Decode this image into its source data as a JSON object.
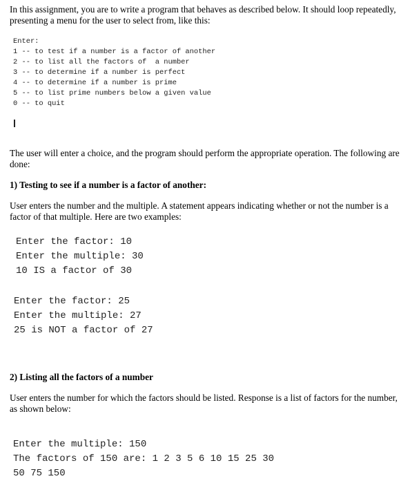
{
  "intro": {
    "line1": "In this assignment, you are to write a program that behaves as described below. It should loop repeatedly,",
    "line2": "presenting a menu for the user to select from, like this:"
  },
  "menu": {
    "header": "Enter:",
    "items": [
      "1 -- to test if a number is a factor of another",
      "2 -- to list all the factors of  a number",
      "3 -- to determine if a number is perfect",
      "4 -- to determine if a number is prime",
      "5 -- to list prime numbers below a given value",
      "0 -- to quit"
    ]
  },
  "choice_paragraph": {
    "line1": "The user will enter a choice, and the program should perform the appropriate operation. The following are",
    "line2": "done:"
  },
  "section1": {
    "heading": "1) Testing to see if a number is a factor of another:",
    "desc_line1": "User enters the number and the multiple. A statement appears indicating whether or not the number is a",
    "desc_line2": "factor of that multiple. Here are two examples:",
    "example1": [
      "Enter the factor: 10",
      "Enter the multiple: 30",
      "10 IS a factor of 30"
    ],
    "example2": [
      "Enter the factor: 25",
      "Enter the multiple: 27",
      "25 is NOT a factor of 27"
    ]
  },
  "section2": {
    "heading": "2)  Listing all the factors of a number",
    "desc_line1": "User enters the number for which the factors should be listed. Response is a list of factors for the number,",
    "desc_line2": "as shown below:",
    "example": [
      "Enter the multiple: 150",
      "The factors of 150 are: 1 2 3 5 6 10 15 25 30",
      "50 75 150"
    ]
  }
}
